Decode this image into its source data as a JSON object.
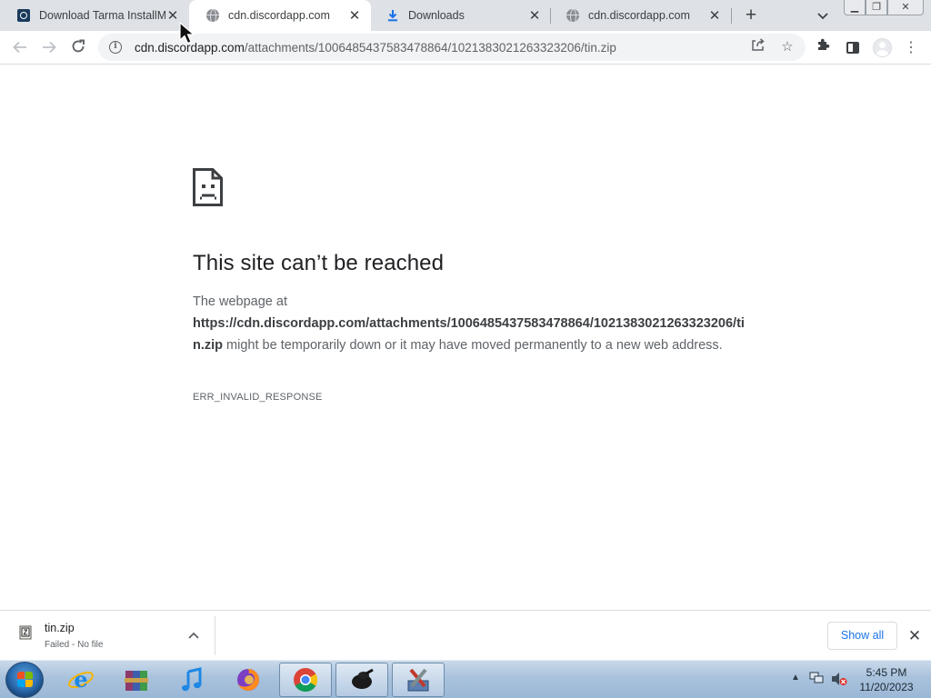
{
  "tabs": [
    {
      "title": "Download Tarma InstallMate",
      "favicon": "installmate-q-icon",
      "active": false
    },
    {
      "title": "cdn.discordapp.com",
      "favicon": "globe-icon",
      "active": true
    },
    {
      "title": "Downloads",
      "favicon": "download-arrow-icon",
      "active": false
    },
    {
      "title": "cdn.discordapp.com",
      "favicon": "globe-icon",
      "active": false
    }
  ],
  "toolbar": {
    "url_host": "cdn.discordapp.com",
    "url_path": "/attachments/1006485437583478864/1021383021263323206/tin.zip"
  },
  "error": {
    "title": "This site can’t be reached",
    "intro": "The webpage at",
    "url": "https://cdn.discordapp.com/attachments/1006485437583478864/1021383021263323206/tin.zip",
    "message": " might be temporarily down or it may have moved permanently to a new web address.",
    "code": "ERR_INVALID_RESPONSE"
  },
  "download_shelf": {
    "filename": "tin.zip",
    "status": "Failed - No file",
    "show_all": "Show all"
  },
  "taskbar": {
    "apps": [
      "internet-explorer",
      "winrar",
      "itunes",
      "firefox",
      "chrome",
      "app-black-blob",
      "app-tools"
    ],
    "time": "5:45 PM",
    "date": "11/20/2023"
  },
  "colors": {
    "link_blue": "#1a73e8",
    "tabstrip_bg": "#dee1e6",
    "omnibox_bg": "#f1f3f4",
    "text_primary": "#202124",
    "text_secondary": "#5f6368"
  }
}
